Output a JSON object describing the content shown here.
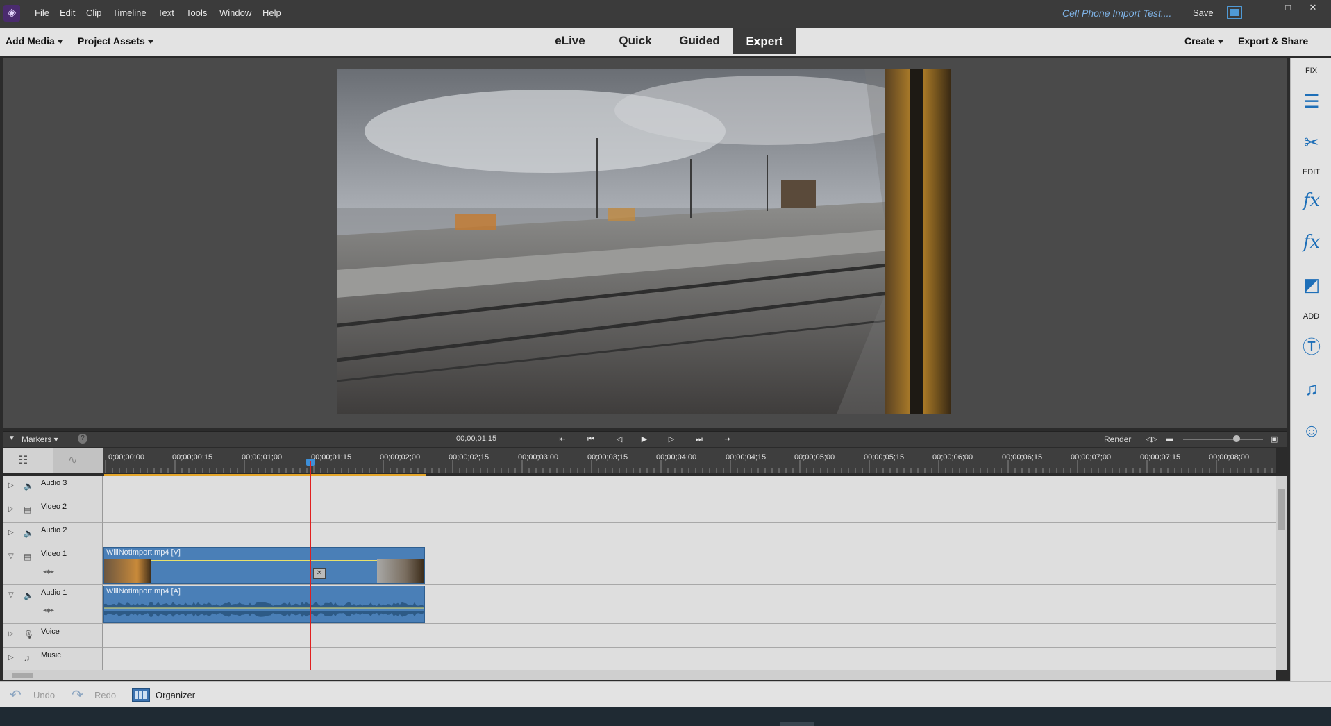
{
  "app": {
    "logo_glyph": "◈",
    "doc_title": "Cell Phone Import Test....",
    "save_label": "Save"
  },
  "menu": [
    "File",
    "Edit",
    "Clip",
    "Timeline",
    "Text",
    "Tools",
    "Window",
    "Help"
  ],
  "window_controls": [
    "–",
    "□",
    "✕"
  ],
  "modebar": {
    "add_media": "Add Media",
    "project_assets": "Project Assets",
    "tabs": [
      "eLive",
      "Quick",
      "Guided",
      "Expert"
    ],
    "active_tab": "Expert",
    "create": "Create",
    "export_share": "Export & Share"
  },
  "right_panel": {
    "fix_label": "FIX",
    "edit_label": "EDIT",
    "add_label": "ADD",
    "icons": [
      "adjustments-icon",
      "tools-icon",
      "applied-effects-icon",
      "effects-icon",
      "transitions-icon",
      "titles-icon",
      "music-icon",
      "graphics-icon"
    ]
  },
  "timeline": {
    "markers_label": "Markers",
    "help_glyph": "?",
    "current_time": "00;00;01;15",
    "render_label": "Render",
    "ruler_ticks": [
      "0;00;00;00",
      "00;00;00;15",
      "00;00;01;00",
      "00;00;01;15",
      "00;00;02;00",
      "00;00;02;15",
      "00;00;03;00",
      "00;00;03;15",
      "00;00;04;00",
      "00;00;04;15",
      "00;00;05;00",
      "00;00;05;15",
      "00;00;06;00",
      "00;00;06;15",
      "00;00;07;00",
      "00;00;07;15",
      "00;00;08;00"
    ],
    "tracks": [
      {
        "name": "Audio 3",
        "icon": "speaker-icon"
      },
      {
        "name": "Video 2",
        "icon": "film-icon"
      },
      {
        "name": "Audio 2",
        "icon": "speaker-icon"
      },
      {
        "name": "Video 1",
        "icon": "film-icon"
      },
      {
        "name": "Audio 1",
        "icon": "speaker-icon"
      },
      {
        "name": "Voice",
        "icon": "microphone-icon"
      },
      {
        "name": "Music",
        "icon": "music-note-icon"
      }
    ],
    "clips": {
      "video": "WillNotImport.mp4 [V]",
      "audio": "WillNotImport.mp4 [A]"
    }
  },
  "bottom": {
    "undo": "Undo",
    "redo": "Redo",
    "organizer": "Organizer"
  },
  "colors": {
    "accent": "#4f9ad6",
    "clip": "#4a7fb7",
    "playhead": "#e02020",
    "work_area": "#e4a62a"
  }
}
